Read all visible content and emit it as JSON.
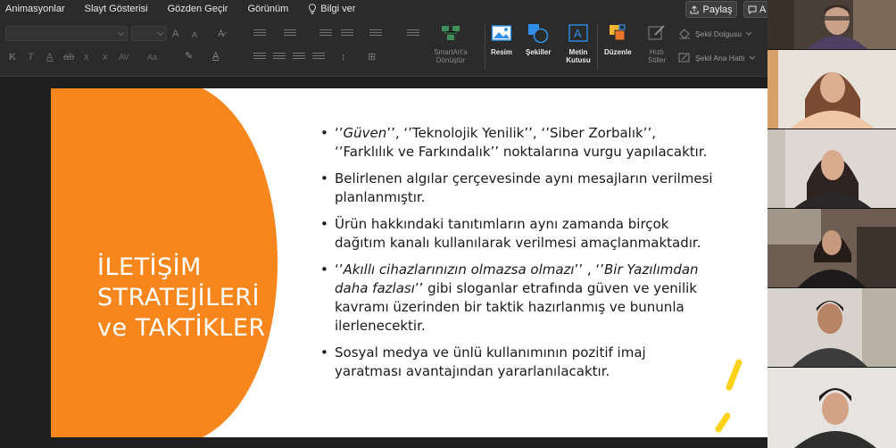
{
  "ribbon": {
    "tabs": [
      "Animasyonlar",
      "Slayt Gösterisi",
      "Gözden Geçir",
      "Görünüm"
    ],
    "tell_me": "Bilgi ver",
    "share": "Paylaş",
    "comments": "A",
    "buttons": {
      "smartart": "SmartArt'a Dönüştür",
      "picture": "Resim",
      "shapes": "Şekiller",
      "textbox": "Metin Kutusu",
      "arrange": "Düzenle",
      "quick_styles": "Hızlı Stiller",
      "shape_fill": "Şekil Dolgusu",
      "shape_outline": "Şekil Ana Hattı"
    },
    "format_letters": [
      "K",
      "T",
      "A",
      "ab",
      "x",
      "x",
      "AV",
      "Aa"
    ],
    "accent": "#e37222"
  },
  "slide": {
    "title_lines": [
      "İLETİŞİM",
      "STRATEJİLERİ",
      "ve TAKTİKLER"
    ],
    "accent_color": "#f7861d",
    "highlight_color": "#ffd21a",
    "bullets": [
      {
        "parts": [
          {
            "t": "‘’",
            "i": false
          },
          {
            "t": "Güven",
            "i": true
          },
          {
            "t": "’’, ‘’Teknolojik Yenilik’’, ‘’Siber Zorbalık’’, ‘’Farklılık ve Farkındalık’’ noktalarına vurgu yapılacaktır.",
            "i": false
          }
        ]
      },
      {
        "parts": [
          {
            "t": " Belirlenen algılar çerçevesinde aynı mesajların verilmesi planlanmıştır.",
            "i": false
          }
        ]
      },
      {
        "parts": [
          {
            "t": " Ürün hakkındaki tanıtımların aynı zamanda birçok dağıtım kanalı kullanılarak verilmesi amaçlanmaktadır.",
            "i": false
          }
        ]
      },
      {
        "parts": [
          {
            "t": " ‘’",
            "i": false
          },
          {
            "t": "Akıllı cihazlarınızın olmazsa olmazı",
            "i": true
          },
          {
            "t": "’’ , ‘’",
            "i": false
          },
          {
            "t": "Bir Yazılımdan daha fazlası",
            "i": true
          },
          {
            "t": "’’ gibi sloganlar etrafında güven ve yenilik kavramı üzerinden bir taktik hazırlanmış ve bununla ilerlenecektir.",
            "i": false
          }
        ]
      },
      {
        "parts": [
          {
            "t": " Sosyal medya ve ünlü kullanımının pozitif imaj yaratması avantajından yararlanılacaktır.",
            "i": false
          }
        ]
      }
    ]
  },
  "video_tiles": [
    "participant-1",
    "participant-2",
    "participant-3",
    "participant-4",
    "participant-5",
    "participant-6"
  ]
}
